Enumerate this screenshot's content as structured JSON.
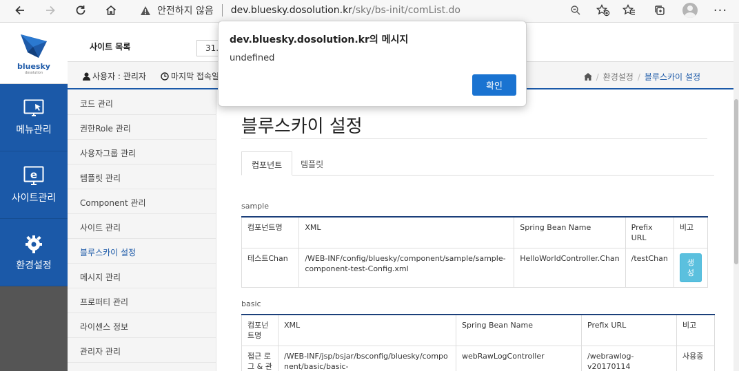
{
  "browser": {
    "security_text": "안전하지 않음",
    "url_host": "dev.bluesky.dosolution.kr",
    "url_path": "/sky/bs-init/comList.do"
  },
  "app": {
    "logo_text": "bluesky",
    "logo_sub": "dosolution",
    "side_menu": [
      {
        "label": "메뉴관리",
        "icon": "monitor-cursor-icon"
      },
      {
        "label": "사이트관리",
        "icon": "monitor-e-icon"
      },
      {
        "label": "환경설정",
        "icon": "gear-icon"
      }
    ]
  },
  "header": {
    "site_list_label": "사이트 목록",
    "site_select_value": "31.b",
    "user_label": "사용자 : 관리자",
    "last_login_label": "마지막 접속일자"
  },
  "breadcrumb": {
    "items": [
      "환경설정",
      "블루스카이 설정"
    ]
  },
  "sub_menu": [
    "코드 관리",
    "권한Role 관리",
    "사용자그룹 관리",
    "템플릿 관리",
    "Component 관리",
    "사이트 관리",
    "블루스카이 설정",
    "메시지 관리",
    "프로퍼티 관리",
    "라이센스 정보",
    "관리자 관리"
  ],
  "page": {
    "title": "블루스카이 설정",
    "tabs": [
      "컴포넌트",
      "템플릿"
    ],
    "sections": [
      {
        "name": "sample",
        "headers": [
          "컴포넌트명",
          "XML",
          "Spring Bean Name",
          "Prefix URL",
          "비고"
        ],
        "rows": [
          {
            "name": "테스트Chan",
            "xml": "/WEB-INF/config/bluesky/component/sample/sample-component-test-Config.xml",
            "bean": "HelloWorldController.Chan",
            "prefix": "/testChan",
            "note": "생성"
          }
        ]
      },
      {
        "name": "basic",
        "headers": [
          "컴포넌트명",
          "XML",
          "Spring Bean Name",
          "Prefix URL",
          "비고"
        ],
        "rows": [
          {
            "name": "접근 로그 & 관",
            "xml": "/WEB-INF/jsp/bsjar/bsconfig/bluesky/component/basic/basic-",
            "bean": "webRawLogController",
            "prefix": "/webrawlog-v20170114",
            "note": "사용중"
          }
        ]
      }
    ]
  },
  "modal": {
    "title": "dev.bluesky.dosolution.kr의 메시지",
    "message": "undefined",
    "ok_label": "확인"
  },
  "colors": {
    "accent": "#1b59a8",
    "modal_button": "#1a73d1",
    "info_button": "#5bc0de"
  }
}
